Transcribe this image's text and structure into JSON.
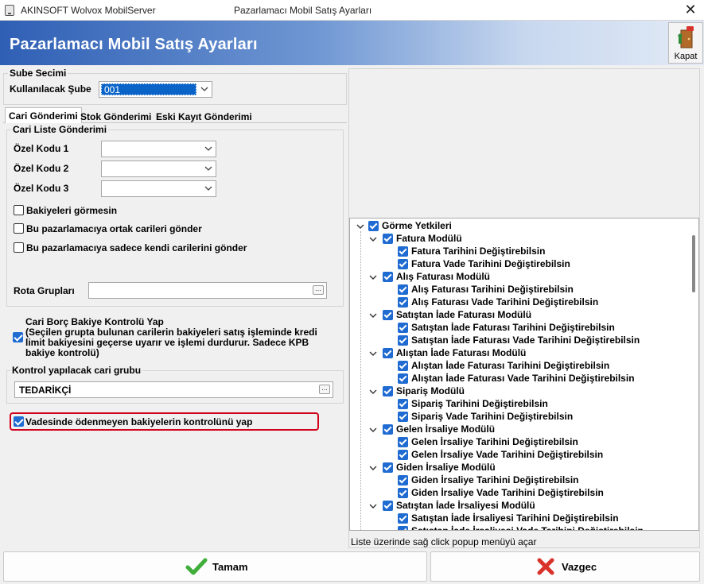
{
  "window": {
    "app_title": "AKINSOFT Wolvox MobilServer",
    "title": "Pazarlamacı Mobil Satış Ayarları",
    "close_glyph": "✕"
  },
  "banner": {
    "title": "Pazarlamacı Mobil Satış Ayarları",
    "close_button_label": "Kapat",
    "close_icon": "exit-door-icon"
  },
  "branch": {
    "group_title": "Sube Secimi",
    "label": "Kullanılacak Şube",
    "value": "001"
  },
  "tabs": [
    {
      "label": "Cari Gönderimi",
      "active": true
    },
    {
      "label": "Stok Gönderimi",
      "active": false
    },
    {
      "label": "Eski Kayıt Gönderimi",
      "active": false
    }
  ],
  "cari": {
    "group_title": "Cari Liste Gönderimi",
    "ozel_kodu_1": {
      "label": "Özel Kodu 1",
      "value": ""
    },
    "ozel_kodu_2": {
      "label": "Özel Kodu 2",
      "value": ""
    },
    "ozel_kodu_3": {
      "label": "Özel Kodu 3",
      "value": ""
    },
    "options": [
      {
        "label": "Bakiyeleri görmesin",
        "checked": false
      },
      {
        "label": "Bu pazarlamacıya ortak carileri gönder",
        "checked": false
      },
      {
        "label": "Bu pazarlamacıya sadece kendi carilerini gönder",
        "checked": false
      }
    ],
    "rota_label": "Rota Grupları",
    "rota_value": ""
  },
  "borc": {
    "title": "Cari Borç Bakiye Kontrolü Yap",
    "checked": true,
    "desc_line1": "(Seçilen grupta bulunan carilerin bakiyeleri satış işleminde kredi",
    "desc_line2": "limit bakiyesini geçerse uyarır ve işlemi durdurur. Sadece KPB",
    "desc_line3": "bakiye kontrolü)",
    "group_label": "Kontrol yapılacak cari grubu",
    "group_value": "TEDARİKÇİ",
    "vadesinde_label": "Vadesinde ödenmeyen bakiyelerin kontrolünü yap",
    "vadesinde_checked": true,
    "highlight_color": "#d0021b"
  },
  "tree": {
    "root": "Görme Yetkileri",
    "modules": [
      {
        "label": "Fatura Modülü",
        "items": [
          "Fatura Tarihini Değiştirebilsin",
          "Fatura Vade Tarihini Değiştirebilsin"
        ]
      },
      {
        "label": "Alış Faturası Modülü",
        "items": [
          "Alış Faturası Tarihini Değiştirebilsin",
          "Alış Faturası Vade Tarihini Değiştirebilsin"
        ]
      },
      {
        "label": "Satıştan İade Faturası Modülü",
        "items": [
          "Satıştan İade Faturası Tarihini Değiştirebilsin",
          "Satıştan İade Faturası Vade Tarihini Değiştirebilsin"
        ]
      },
      {
        "label": "Alıştan İade Faturası Modülü",
        "items": [
          "Alıştan İade Faturası Tarihini Değiştirebilsin",
          "Alıştan İade Faturası Vade Tarihini Değiştirebilsin"
        ]
      },
      {
        "label": "Sipariş Modülü",
        "items": [
          "Sipariş Tarihini Değiştirebilsin",
          "Sipariş Vade Tarihini Değiştirebilsin"
        ]
      },
      {
        "label": "Gelen İrsaliye Modülü",
        "items": [
          "Gelen İrsaliye Tarihini Değiştirebilsin",
          "Gelen İrsaliye Vade Tarihini Değiştirebilsin"
        ]
      },
      {
        "label": "Giden İrsaliye Modülü",
        "items": [
          "Giden İrsaliye Tarihini Değiştirebilsin",
          "Giden İrsaliye Vade Tarihini Değiştirebilsin"
        ]
      },
      {
        "label": "Satıştan İade İrsaliyesi Modülü",
        "items": [
          "Satıştan İade İrsaliyesi Tarihini Değiştirebilsin",
          "Satıştan İade İrsaliyesi Vade Tarihini Değiştirebilsin"
        ]
      }
    ],
    "hint": "Liste üzerinde sağ click popup menüyü açar"
  },
  "buttons": {
    "ok": "Tamam",
    "ok_icon": "green-checkmark-icon",
    "cancel": "Vazgec",
    "cancel_icon": "red-x-icon"
  }
}
